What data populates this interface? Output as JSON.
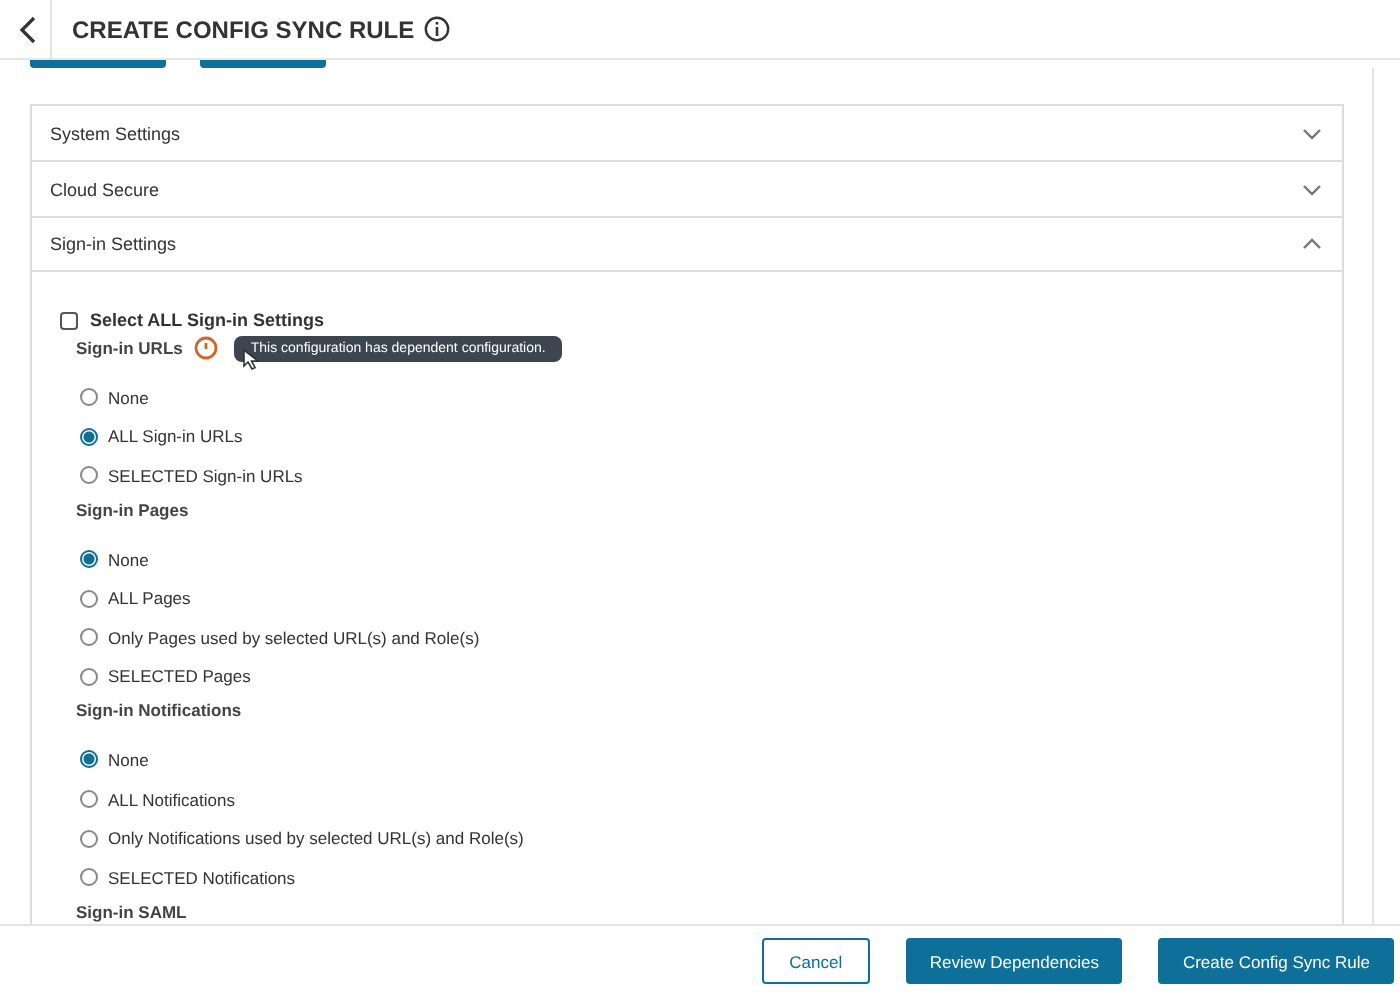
{
  "header": {
    "title": "CREATE CONFIG SYNC RULE"
  },
  "accordion": [
    {
      "label": "System Settings",
      "expanded": false
    },
    {
      "label": "Cloud Secure",
      "expanded": false
    },
    {
      "label": "Sign-in Settings",
      "expanded": true
    }
  ],
  "select_all": {
    "label": "Select ALL Sign-in Settings",
    "checked": false
  },
  "groups": [
    {
      "heading": "Sign-in URLs",
      "tooltip": "This configuration has dependent configuration.",
      "options": [
        {
          "label": "None",
          "selected": false
        },
        {
          "label": "ALL Sign-in URLs",
          "selected": true
        },
        {
          "label": "SELECTED Sign-in URLs",
          "selected": false
        }
      ]
    },
    {
      "heading": "Sign-in Pages",
      "options": [
        {
          "label": "None",
          "selected": true
        },
        {
          "label": "ALL Pages",
          "selected": false
        },
        {
          "label": "Only Pages used by selected URL(s) and Role(s)",
          "selected": false
        },
        {
          "label": "SELECTED Pages",
          "selected": false
        }
      ]
    },
    {
      "heading": "Sign-in Notifications",
      "options": [
        {
          "label": "None",
          "selected": true
        },
        {
          "label": "ALL Notifications",
          "selected": false
        },
        {
          "label": "Only Notifications used by selected URL(s) and Role(s)",
          "selected": false
        },
        {
          "label": "SELECTED Notifications",
          "selected": false
        }
      ]
    },
    {
      "heading": "Sign-in SAML"
    }
  ],
  "footer": {
    "buttons": [
      {
        "label": "Cancel",
        "kind": "secondary"
      },
      {
        "label": "Review Dependencies",
        "kind": "primary"
      },
      {
        "label": "Create Config Sync Rule",
        "kind": "primary"
      }
    ]
  }
}
